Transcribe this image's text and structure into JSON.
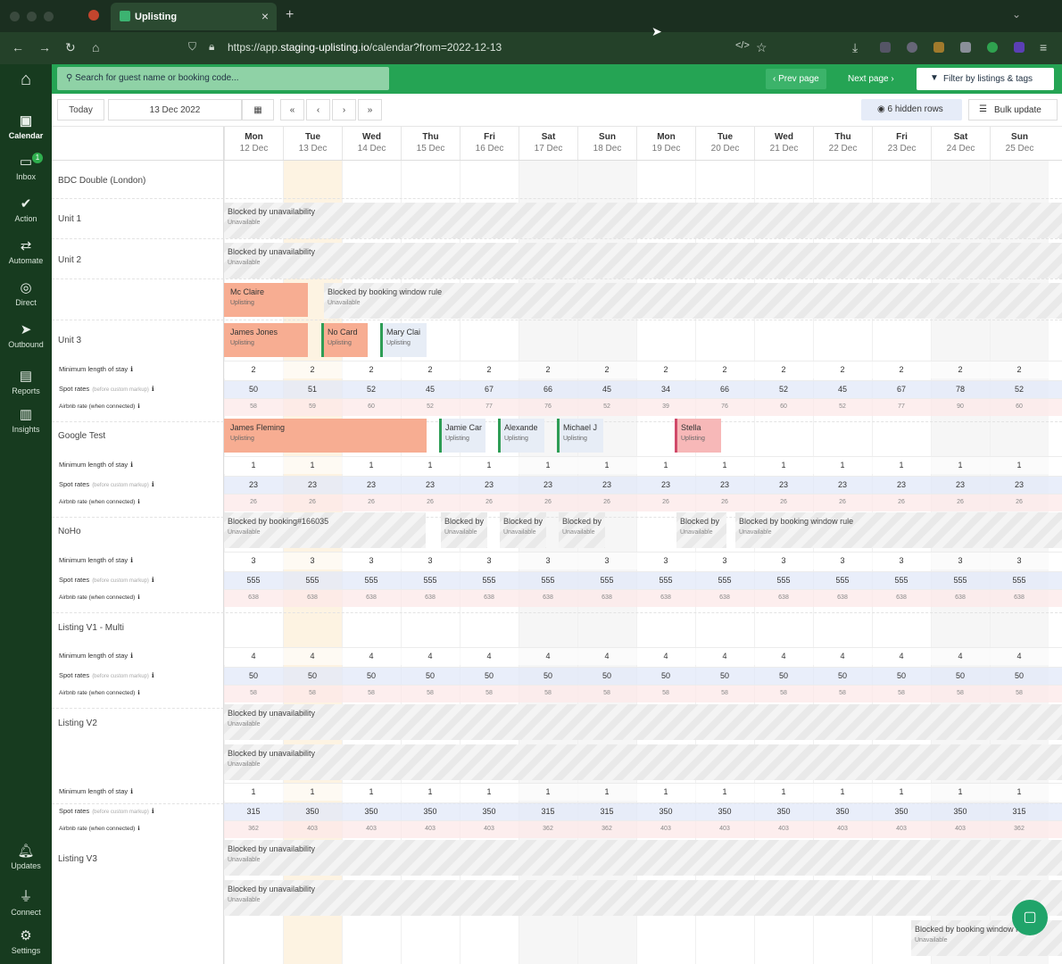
{
  "browser": {
    "tab_title": "Uplisting",
    "url_pre": "https://app.",
    "url_host": "staging-uplisting.io",
    "url_post": "/calendar?from=2022-12-13"
  },
  "sidebar": [
    {
      "label": "Calendar",
      "icon": "calendar-icon"
    },
    {
      "label": "Inbox",
      "icon": "inbox-icon",
      "badge": "1"
    },
    {
      "label": "Action",
      "icon": "check-icon"
    },
    {
      "label": "Automate",
      "icon": "shuffle-icon"
    },
    {
      "label": "Direct",
      "icon": "direct-icon"
    },
    {
      "label": "Outbound",
      "icon": "send-icon"
    },
    {
      "label": "Reports",
      "icon": "reports-icon"
    },
    {
      "label": "Insights",
      "icon": "insights-icon"
    },
    {
      "label": "Updates",
      "icon": "bell-icon"
    },
    {
      "label": "Connect",
      "icon": "plug-icon"
    },
    {
      "label": "Settings",
      "icon": "gear-icon"
    }
  ],
  "topbar": {
    "search_placeholder": "Search for guest name or booking code...",
    "prev": "Prev page",
    "next": "Next page",
    "filter": "Filter by listings & tags"
  },
  "toolbar": {
    "today": "Today",
    "date": "13 Dec 2022",
    "first": "«",
    "prev": "‹",
    "next": "›",
    "last": "»",
    "hidden_rows": "6 hidden rows",
    "bulk": "Bulk update"
  },
  "days": [
    {
      "d": "Mon",
      "n": "12 Dec"
    },
    {
      "d": "Tue",
      "n": "13 Dec"
    },
    {
      "d": "Wed",
      "n": "14 Dec"
    },
    {
      "d": "Thu",
      "n": "15 Dec"
    },
    {
      "d": "Fri",
      "n": "16 Dec"
    },
    {
      "d": "Sat",
      "n": "17 Dec"
    },
    {
      "d": "Sun",
      "n": "18 Dec"
    },
    {
      "d": "Mon",
      "n": "19 Dec"
    },
    {
      "d": "Tue",
      "n": "20 Dec"
    },
    {
      "d": "Wed",
      "n": "21 Dec"
    },
    {
      "d": "Thu",
      "n": "22 Dec"
    },
    {
      "d": "Fri",
      "n": "23 Dec"
    },
    {
      "d": "Sat",
      "n": "24 Dec"
    },
    {
      "d": "Sun",
      "n": "25 Dec"
    }
  ],
  "labels": {
    "min": "Minimum length of stay",
    "spot": "Spot rates",
    "spot_note": "(before custom markup)",
    "air": "Airbnb rate (when connected)",
    "info": "ℹ"
  },
  "properties": [
    "BDC Double (London)",
    "Unit 1",
    "Unit 2",
    "Unit 3",
    "Google Test",
    "NoHo",
    "Listing V1 - Multi",
    "Listing V2",
    "Listing V3"
  ],
  "rates": [
    {
      "min": [
        "2",
        "2",
        "2",
        "2",
        "2",
        "2",
        "2",
        "2",
        "2",
        "2",
        "2",
        "2",
        "2",
        "2"
      ],
      "spot": [
        "50",
        "51",
        "52",
        "45",
        "67",
        "66",
        "45",
        "34",
        "66",
        "52",
        "45",
        "67",
        "78",
        "52"
      ],
      "air": [
        "58",
        "59",
        "60",
        "52",
        "77",
        "76",
        "52",
        "39",
        "76",
        "60",
        "52",
        "77",
        "90",
        "60"
      ]
    },
    {
      "min": [
        "1",
        "1",
        "1",
        "1",
        "1",
        "1",
        "1",
        "1",
        "1",
        "1",
        "1",
        "1",
        "1",
        "1"
      ],
      "spot": [
        "23",
        "23",
        "23",
        "23",
        "23",
        "23",
        "23",
        "23",
        "23",
        "23",
        "23",
        "23",
        "23",
        "23"
      ],
      "air": [
        "26",
        "26",
        "26",
        "26",
        "26",
        "26",
        "26",
        "26",
        "26",
        "26",
        "26",
        "26",
        "26",
        "26"
      ]
    },
    {
      "min": [
        "3",
        "3",
        "3",
        "3",
        "3",
        "3",
        "3",
        "3",
        "3",
        "3",
        "3",
        "3",
        "3",
        "3"
      ],
      "spot": [
        "555",
        "555",
        "555",
        "555",
        "555",
        "555",
        "555",
        "555",
        "555",
        "555",
        "555",
        "555",
        "555",
        "555"
      ],
      "air": [
        "638",
        "638",
        "638",
        "638",
        "638",
        "638",
        "638",
        "638",
        "638",
        "638",
        "638",
        "638",
        "638",
        "638"
      ]
    },
    {
      "min": [
        "4",
        "4",
        "4",
        "4",
        "4",
        "4",
        "4",
        "4",
        "4",
        "4",
        "4",
        "4",
        "4",
        "4"
      ],
      "spot": [
        "50",
        "50",
        "50",
        "50",
        "50",
        "50",
        "50",
        "50",
        "50",
        "50",
        "50",
        "50",
        "50",
        "50"
      ],
      "air": [
        "58",
        "58",
        "58",
        "58",
        "58",
        "58",
        "58",
        "58",
        "58",
        "58",
        "58",
        "58",
        "58",
        "58"
      ]
    },
    {
      "min": [
        "1",
        "1",
        "1",
        "1",
        "1",
        "1",
        "1",
        "1",
        "1",
        "1",
        "1",
        "1",
        "1",
        "1"
      ],
      "spot": [
        "315",
        "350",
        "350",
        "350",
        "350",
        "315",
        "315",
        "350",
        "350",
        "350",
        "350",
        "350",
        "350",
        "315"
      ],
      "air": [
        "362",
        "403",
        "403",
        "403",
        "403",
        "362",
        "362",
        "403",
        "403",
        "403",
        "403",
        "403",
        "403",
        "362"
      ]
    }
  ],
  "blocks": {
    "unavail": "Blocked by unavailability",
    "window": "Blocked by booking window rule",
    "booking": "Blocked by booking#166035",
    "blocked": "Blocked by",
    "sub": "Unavailable",
    "source": "Uplisting"
  },
  "bookings": {
    "b1": "Mc Claire",
    "b2": "James Jones",
    "b3": "No Card",
    "b4": "Mary Clai",
    "b5": "James Fleming",
    "b6": "Jamie Car",
    "b7": "Alexande",
    "b8": "Michael J",
    "b9": "Stella"
  },
  "colors": {
    "accent": "#25a454",
    "sidebar": "#173b1f",
    "booking_orange": "#f7ad92",
    "booking_red": "#f7b8b8",
    "booking_blue": "#e7edf6"
  }
}
